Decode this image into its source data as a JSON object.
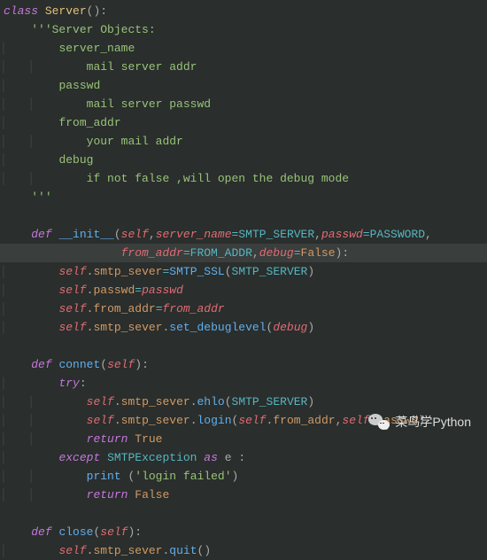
{
  "code": {
    "class_kw": "class",
    "class_name": "Server",
    "paren_open": "(",
    "paren_close": ")",
    "colon": ":",
    "docstring": {
      "open": "'''",
      "title": "Server Objects:",
      "l1": "server_name",
      "l1d": "mail server addr",
      "l2": "passwd",
      "l2d": "mail server passwd",
      "l3": "from_addr",
      "l3d": "your mail addr",
      "l4": "debug",
      "l4d": "if not false ,will open the debug mode",
      "close": "'''"
    },
    "def_kw": "def",
    "init_name": "__init__",
    "self": "self",
    "server_name_p": "server_name",
    "SMTP_SERVER": "SMTP_SERVER",
    "passwd_p": "passwd",
    "PASSWORD": "PASSWORD",
    "from_addr_p": "from_addr",
    "FROM_ADDR": "FROM_ADDR",
    "debug_p": "debug",
    "False": "False",
    "eq": "=",
    "comma": ",",
    "dot": ".",
    "smtp_sever": "smtp_sever",
    "SMTP_SSL": "SMTP_SSL",
    "from_addr": "from_addr",
    "set_debuglevel": "set_debuglevel",
    "connet_name": "connet",
    "try_kw": "try",
    "ehlo": "ehlo",
    "login": "login",
    "return_kw": "return",
    "True": "True",
    "except_kw": "except",
    "SMTPException": "SMTPException",
    "as_kw": "as",
    "e_var": "e",
    "print_fn": "print",
    "login_failed": "'login failed'",
    "close_name": "close",
    "quit": "quit",
    "passwd": "passwd"
  },
  "watermark": {
    "text": "菜鸟学Python"
  }
}
